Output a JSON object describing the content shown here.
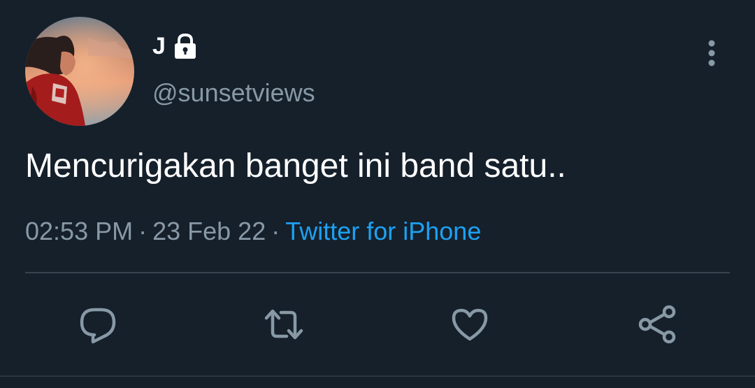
{
  "user": {
    "display_name": "J",
    "handle": "@sunsetviews",
    "avatar_icon": "profile-photo-sunset",
    "lock_icon": "lock-icon"
  },
  "tweet": {
    "text": "Mencurigakan banget ini band satu..",
    "time": "02:53 PM",
    "separator": "·",
    "date": "23 Feb 22",
    "source": "Twitter for iPhone"
  },
  "actions": {
    "reply_icon": "reply-icon",
    "retweet_icon": "retweet-icon",
    "like_icon": "heart-icon",
    "share_icon": "share-icon",
    "more_icon": "more-vertical-icon"
  },
  "colors": {
    "background": "#15202b",
    "text_primary": "#ffffff",
    "text_secondary": "#8899a6",
    "link": "#1da1f2",
    "divider": "#38444d",
    "icon": "#8899a6"
  }
}
